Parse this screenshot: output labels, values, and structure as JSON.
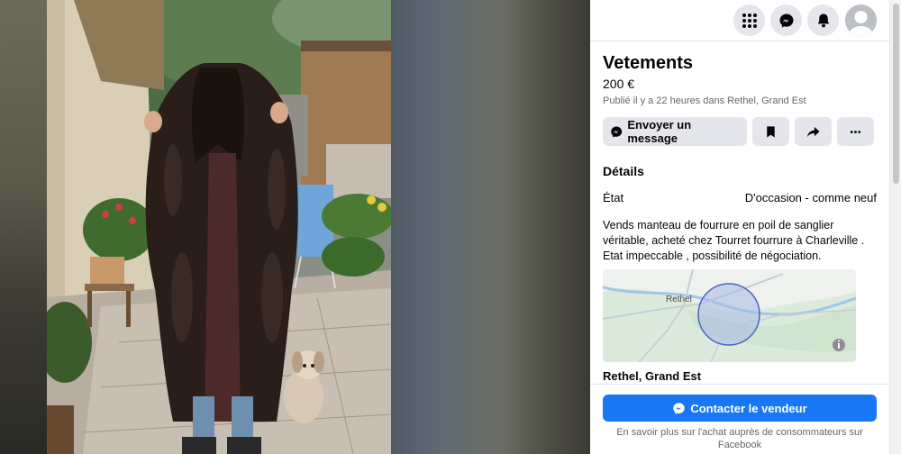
{
  "topbar": {
    "icons": [
      "menu-grid-icon",
      "messenger-icon",
      "bell-icon",
      "avatar"
    ]
  },
  "listing": {
    "title": "Vetements",
    "price": "200 €",
    "meta": "Publié il y a 22 heures dans Rethel, Grand Est",
    "message_button": "Envoyer un message",
    "details_title": "Détails",
    "condition_label": "État",
    "condition_value": "D'occasion - comme neuf",
    "description": "Vends manteau de fourrure en poil de sanglier véritable,  acheté  chez Tourret fourrure à Charleville . Etat impeccable , possibilité de négociation.",
    "map_label": "Rethel",
    "location": "Rethel, Grand Est"
  },
  "footer": {
    "contact_button": "Contacter le vendeur",
    "learn_more": "En savoir plus sur l'achat auprès de consommateurs sur Facebook"
  },
  "colors": {
    "accent": "#1877f2",
    "button_gray": "#e4e6eb",
    "secondary_text": "#65676b"
  }
}
